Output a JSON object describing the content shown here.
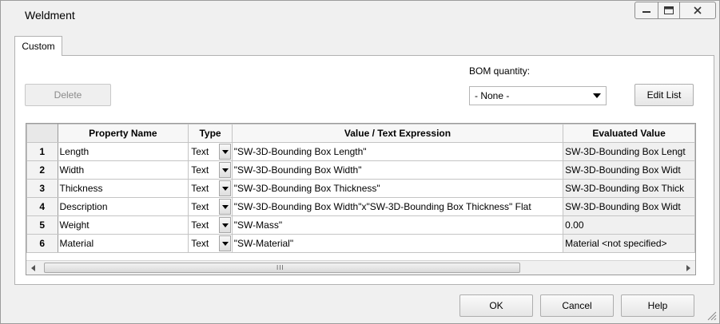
{
  "window": {
    "title": "Weldment",
    "controls": [
      {
        "name": "minimize-icon"
      },
      {
        "name": "maximize-icon"
      },
      {
        "name": "close-icon"
      }
    ]
  },
  "tabs": [
    {
      "label": "Custom",
      "active": true
    }
  ],
  "toolbar": {
    "delete_label": "Delete",
    "delete_enabled": false,
    "bom_label": "BOM quantity:",
    "bom_value": "- None -",
    "edit_list_label": "Edit List"
  },
  "grid": {
    "columns": [
      "",
      "Property Name",
      "Type",
      "Value / Text Expression",
      "Evaluated Value"
    ],
    "rows": [
      {
        "num": "1",
        "name": "Length",
        "type": "Text",
        "value": "\"SW-3D-Bounding Box Length\"",
        "evaluated": "SW-3D-Bounding Box Lengt"
      },
      {
        "num": "2",
        "name": "Width",
        "type": "Text",
        "value": "\"SW-3D-Bounding Box Width\"",
        "evaluated": "SW-3D-Bounding Box Widt"
      },
      {
        "num": "3",
        "name": "Thickness",
        "type": "Text",
        "value": "\"SW-3D-Bounding Box Thickness\"",
        "evaluated": "SW-3D-Bounding Box Thick"
      },
      {
        "num": "4",
        "name": "Description",
        "type": "Text",
        "value": "\"SW-3D-Bounding Box Width\"x\"SW-3D-Bounding Box Thickness\" Flat",
        "evaluated": "SW-3D-Bounding Box Widt"
      },
      {
        "num": "5",
        "name": "Weight",
        "type": "Text",
        "value": "\"SW-Mass\"",
        "evaluated": "0.00"
      },
      {
        "num": "6",
        "name": "Material",
        "type": "Text",
        "value": "\"SW-Material\"",
        "evaluated": "Material <not specified>"
      }
    ],
    "scroll_grip": "III"
  },
  "footer": {
    "ok_label": "OK",
    "cancel_label": "Cancel",
    "help_label": "Help"
  },
  "colors": {
    "dialog_bg": "#f0f0f0",
    "panel_bg": "#ffffff",
    "evaluated_bg": "#f0f0f0"
  }
}
